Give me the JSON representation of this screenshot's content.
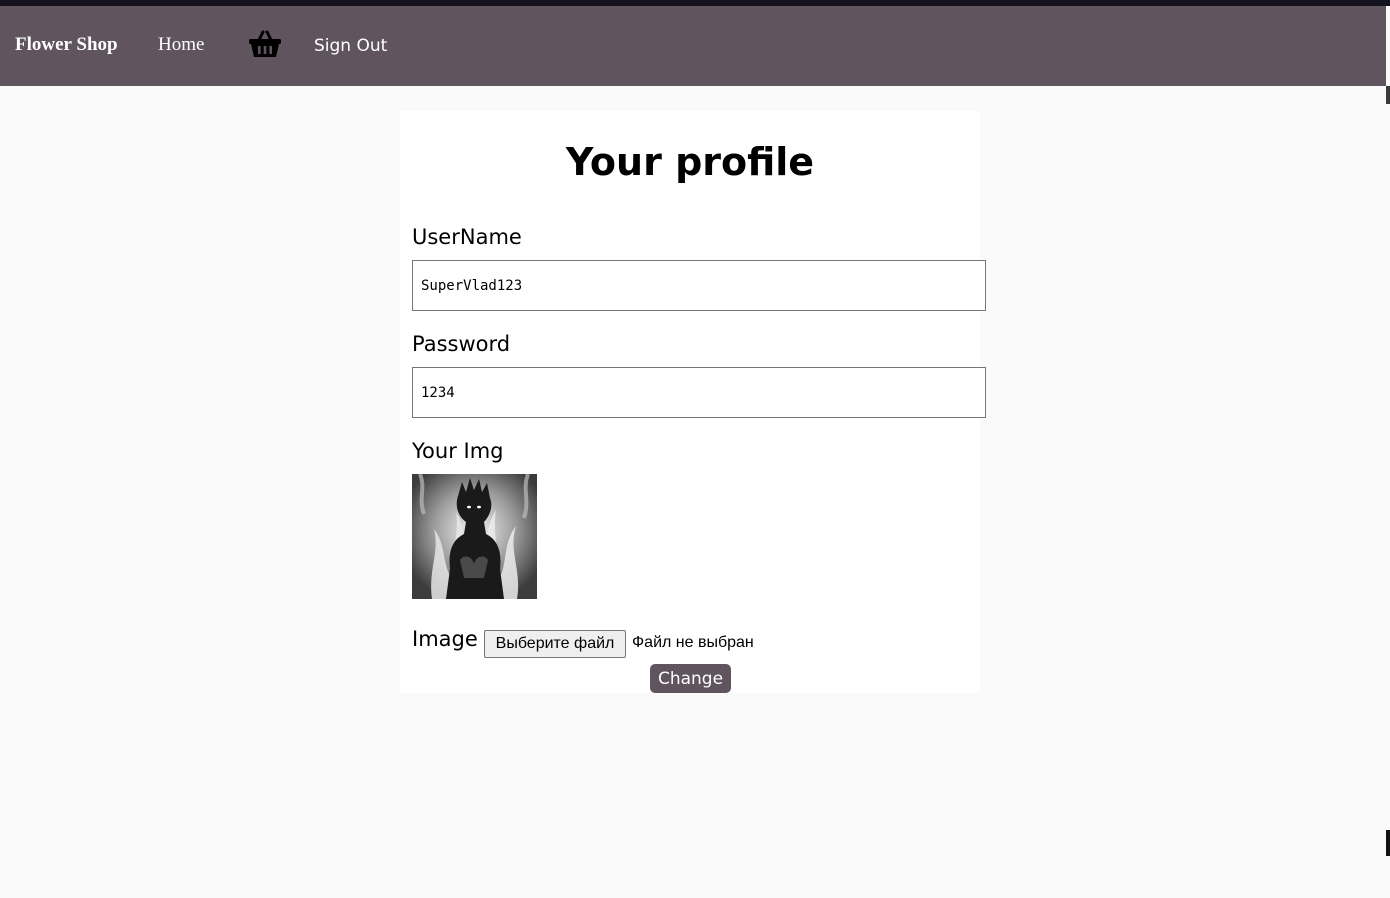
{
  "navbar": {
    "brand": "Flower Shop",
    "home_label": "Home",
    "cart_icon": "shopping-basket-icon",
    "signout_label": "Sign Out",
    "background_color": "#60555f"
  },
  "profile": {
    "title": "Your profile",
    "username_label": "UserName",
    "username_value": "SuperVlad123",
    "password_label": "Password",
    "password_value": "1234",
    "image_section_label": "Your Img",
    "file_label": "Image",
    "file_button_label": "Выберите файл",
    "file_status": "Файл не выбран",
    "submit_label": "Change"
  },
  "colors": {
    "accent": "#60555f",
    "page_background": "#fafafa",
    "card_background": "#ffffff"
  }
}
